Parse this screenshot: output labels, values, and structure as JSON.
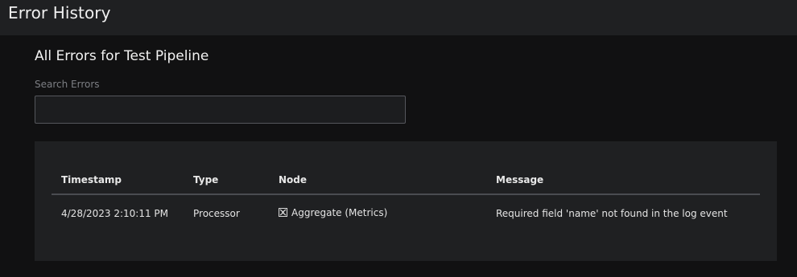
{
  "header": {
    "title": "Error History"
  },
  "main": {
    "title": "All Errors for Test Pipeline",
    "search": {
      "label": "Search Errors",
      "value": "",
      "placeholder": ""
    },
    "table": {
      "columns": [
        "Timestamp",
        "Type",
        "Node",
        "Message"
      ],
      "rows": [
        {
          "timestamp": "4/28/2023 2:10:11 PM",
          "type": "Processor",
          "node_icon": "aggregate-icon",
          "node": "Aggregate (Metrics)",
          "message": "Required field 'name' not found in the log event"
        }
      ]
    }
  }
}
